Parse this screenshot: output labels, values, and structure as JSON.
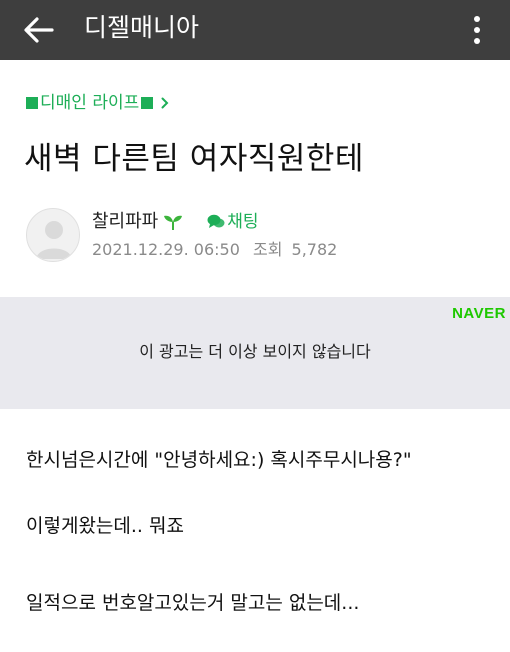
{
  "header": {
    "title": "디젤매니아",
    "back_icon": "arrow-left-icon",
    "more_icon": "more-vertical-icon"
  },
  "post": {
    "category": "디매인 라이프",
    "title": "새벽 다른팀 여자직원한테",
    "author": "찰리파파",
    "chat_label": "채팅",
    "date": "2021.12.29. 06:50",
    "views_label": "조회",
    "views": "5,782",
    "body": [
      "한시넘은시간에 \"안녕하세요:) 혹시주무시나용?\"",
      "이렇게왔는데.. 뭐죠",
      "일적으로 번호알고있는거 말고는 없는데..."
    ]
  },
  "ad": {
    "brand": "NAVER",
    "message": "이 광고는 더 이상 보이지 않습니다"
  },
  "colors": {
    "header_bg": "#3e3e3e",
    "accent_green": "#1dae57",
    "naver_green": "#1ec800",
    "ad_bg": "#e9e9ee"
  }
}
